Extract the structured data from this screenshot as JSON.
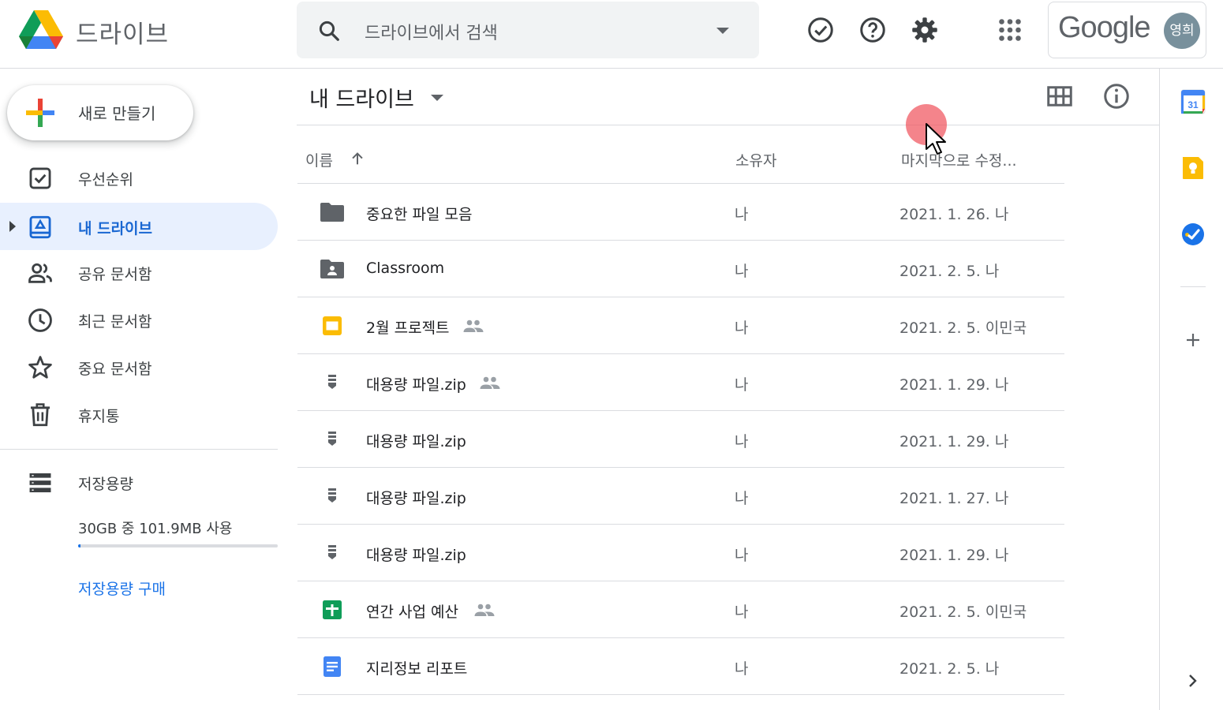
{
  "header": {
    "app_name": "드라이브",
    "search_placeholder": "드라이브에서 검색",
    "google_text": "Google",
    "avatar_initials": "영희",
    "icons": [
      "check-circle-icon",
      "help-icon",
      "settings-icon",
      "apps-grid-icon"
    ]
  },
  "sidebar": {
    "new_button_label": "새로 만들기",
    "items": [
      {
        "label": "우선순위",
        "icon": "priority-icon",
        "active": false
      },
      {
        "label": "내 드라이브",
        "icon": "my-drive-icon",
        "active": true
      },
      {
        "label": "공유 문서함",
        "icon": "shared-icon",
        "active": false
      },
      {
        "label": "최근 문서함",
        "icon": "recent-clock-icon",
        "active": false
      },
      {
        "label": "중요 문서함",
        "icon": "star-icon",
        "active": false
      },
      {
        "label": "휴지통",
        "icon": "trash-icon",
        "active": false
      }
    ],
    "storage": {
      "label": "저장용량",
      "usage_text": "30GB 중 101.9MB 사용",
      "used_fraction": 0.003,
      "buy_link": "저장용량 구매"
    }
  },
  "main": {
    "title": "내 드라이브",
    "columns": {
      "name": "이름",
      "owner": "소유자",
      "modified": "마지막으로 수정..."
    },
    "files": [
      {
        "name": "중요한 파일 모음",
        "type": "folder",
        "shared": false,
        "owner": "나",
        "modified": "2021. 1. 26. 나"
      },
      {
        "name": "Classroom",
        "type": "shared-folder",
        "shared": false,
        "owner": "나",
        "modified": "2021. 2. 5. 나"
      },
      {
        "name": "2월 프로젝트",
        "type": "slides",
        "shared": true,
        "owner": "나",
        "modified": "2021. 2. 5. 이민국"
      },
      {
        "name": "대용량 파일.zip",
        "type": "zip",
        "shared": true,
        "owner": "나",
        "modified": "2021. 1. 29. 나"
      },
      {
        "name": "대용량 파일.zip",
        "type": "zip",
        "shared": false,
        "owner": "나",
        "modified": "2021. 1. 29. 나"
      },
      {
        "name": "대용량 파일.zip",
        "type": "zip",
        "shared": false,
        "owner": "나",
        "modified": "2021. 1. 27. 나"
      },
      {
        "name": "대용량 파일.zip",
        "type": "zip",
        "shared": false,
        "owner": "나",
        "modified": "2021. 1. 29. 나"
      },
      {
        "name": "연간 사업 예산",
        "type": "sheets",
        "shared": true,
        "owner": "나",
        "modified": "2021. 2. 5. 이민국"
      },
      {
        "name": "지리정보 리포트",
        "type": "docs",
        "shared": false,
        "owner": "나",
        "modified": "2021. 2. 5. 나"
      }
    ]
  },
  "right_panel": {
    "calendar_day": "31",
    "icons": [
      "calendar-icon",
      "keep-icon",
      "tasks-icon",
      "add-icon",
      "chevron-right-icon"
    ]
  },
  "colors": {
    "accent_blue": "#1a73e8",
    "active_bg": "#e8f0fe",
    "keep_yellow": "#fbbc04",
    "sheets_green": "#0f9d58",
    "docs_blue": "#4285f4"
  }
}
